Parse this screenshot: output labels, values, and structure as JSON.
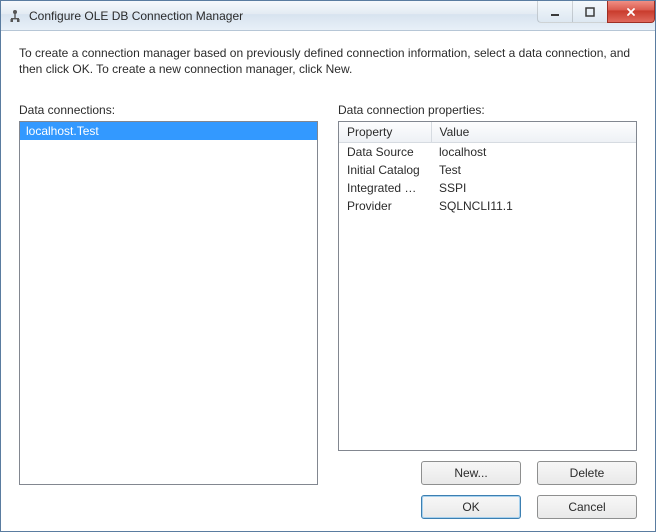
{
  "window": {
    "title": "Configure OLE DB Connection Manager"
  },
  "description": "To create a connection manager based on previously defined connection information, select a data connection, and then click OK. To create a new connection manager, click New.",
  "labels": {
    "data_connections": "Data connections:",
    "data_connection_properties": "Data connection properties:"
  },
  "connections": [
    {
      "name": "localhost.Test",
      "selected": true
    }
  ],
  "property_headers": {
    "property": "Property",
    "value": "Value"
  },
  "properties": [
    {
      "name": "Data Source",
      "value": "localhost"
    },
    {
      "name": "Initial Catalog",
      "value": "Test"
    },
    {
      "name": "Integrated Se...",
      "value": "SSPI"
    },
    {
      "name": "Provider",
      "value": "SQLNCLI11.1"
    }
  ],
  "buttons": {
    "new": "New...",
    "delete": "Delete",
    "ok": "OK",
    "cancel": "Cancel"
  }
}
